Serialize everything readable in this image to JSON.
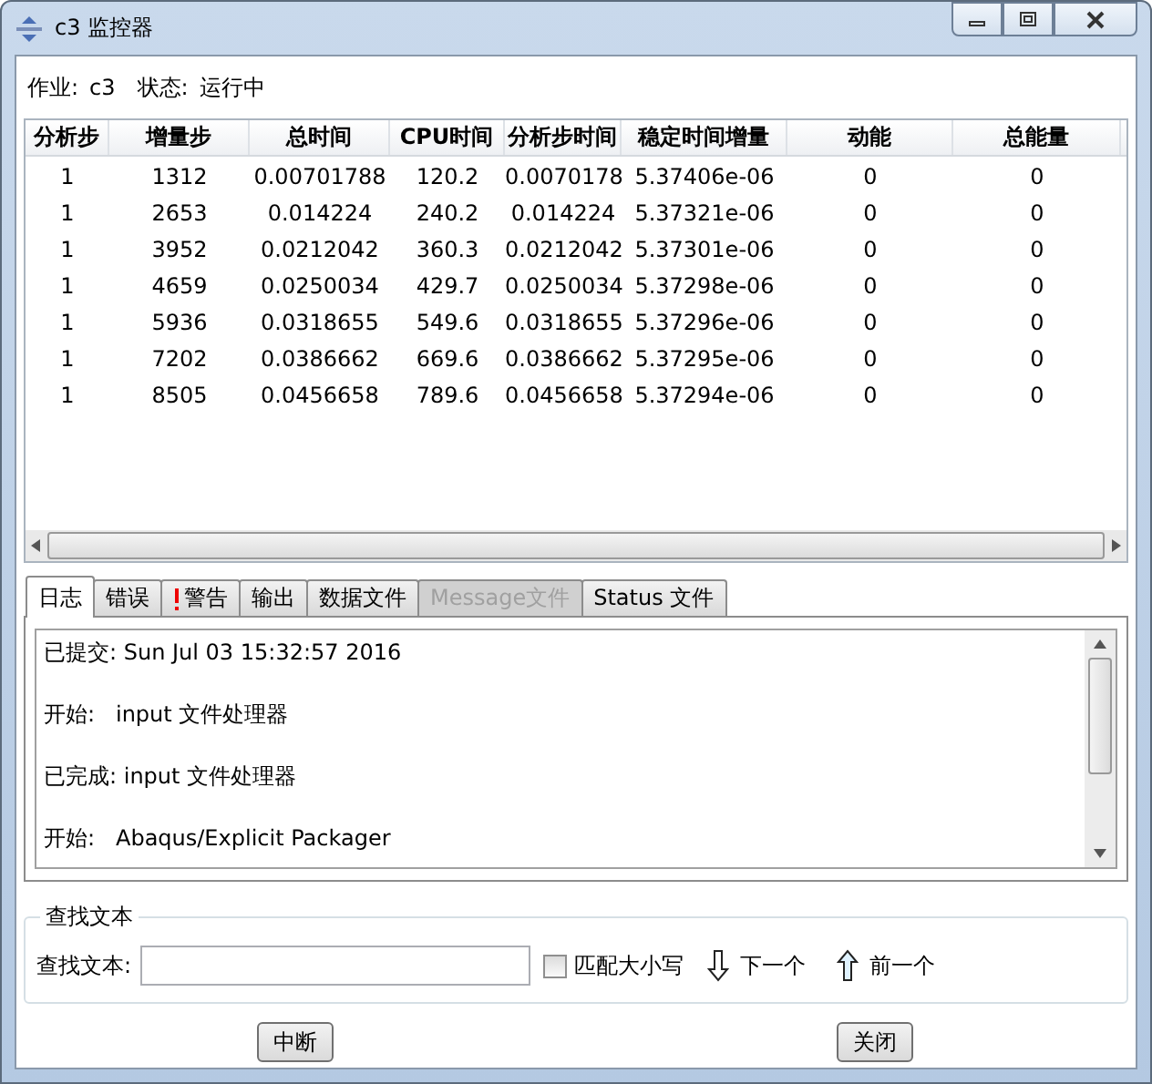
{
  "window": {
    "title": "c3 监控器"
  },
  "job": {
    "job_label": "作业:",
    "job_value": "c3",
    "status_label": "状态:",
    "status_value": "运行中"
  },
  "table": {
    "columns": [
      "分析步",
      "增量步",
      "总时间",
      "CPU时间",
      "分析步时间",
      "稳定时间增量",
      "动能",
      "总能量"
    ],
    "rows": [
      [
        "1",
        "1312",
        "0.00701788",
        "120.2",
        "0.0070178",
        "5.37406e-06",
        "0",
        "0"
      ],
      [
        "1",
        "2653",
        "0.014224",
        "240.2",
        "0.014224",
        "5.37321e-06",
        "0",
        "0"
      ],
      [
        "1",
        "3952",
        "0.0212042",
        "360.3",
        "0.0212042",
        "5.37301e-06",
        "0",
        "0"
      ],
      [
        "1",
        "4659",
        "0.0250034",
        "429.7",
        "0.0250034",
        "5.37298e-06",
        "0",
        "0"
      ],
      [
        "1",
        "5936",
        "0.0318655",
        "549.6",
        "0.0318655",
        "5.37296e-06",
        "0",
        "0"
      ],
      [
        "1",
        "7202",
        "0.0386662",
        "669.6",
        "0.0386662",
        "5.37295e-06",
        "0",
        "0"
      ],
      [
        "1",
        "8505",
        "0.0456658",
        "789.6",
        "0.0456658",
        "5.37294e-06",
        "0",
        "0"
      ]
    ]
  },
  "tabs": [
    {
      "label": "日志",
      "selected": true,
      "disabled": false,
      "kind": "plain"
    },
    {
      "label": "错误",
      "selected": false,
      "disabled": false,
      "kind": "plain"
    },
    {
      "label": "警告",
      "selected": false,
      "disabled": false,
      "kind": "warning"
    },
    {
      "label": "输出",
      "selected": false,
      "disabled": false,
      "kind": "plain"
    },
    {
      "label": "数据文件",
      "selected": false,
      "disabled": false,
      "kind": "plain"
    },
    {
      "label": "Message文件",
      "selected": false,
      "disabled": true,
      "kind": "plain"
    },
    {
      "label": "Status 文件",
      "selected": false,
      "disabled": false,
      "kind": "plain"
    }
  ],
  "log": [
    "已提交: Sun Jul 03 15:32:57 2016",
    "开始:   input 文件处理器",
    "已完成: input 文件处理器",
    "开始:   Abaqus/Explicit Packager"
  ],
  "find": {
    "legend": "查找文本",
    "label": "查找文本:",
    "match_case": {
      "label": "匹配大小写",
      "checked": false
    },
    "next": "下一个",
    "previous": "前一个"
  },
  "buttons": [
    "中断",
    "关闭"
  ]
}
